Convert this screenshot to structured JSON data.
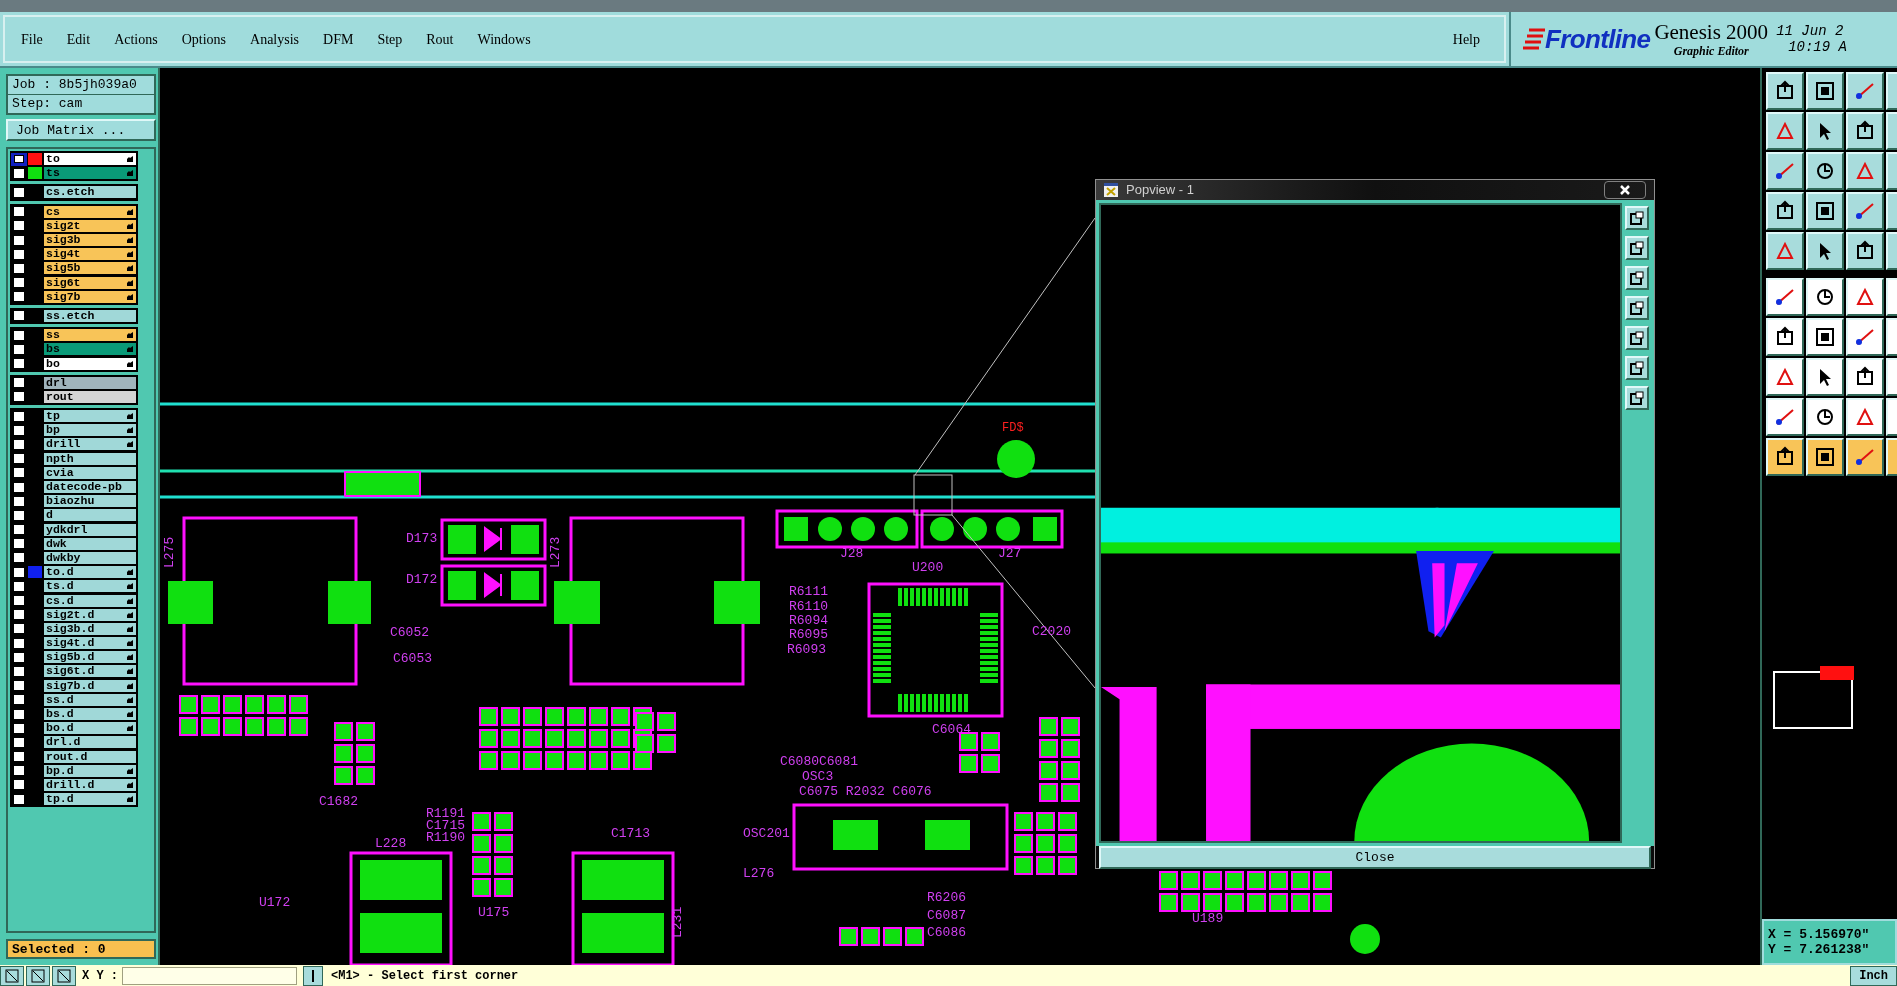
{
  "menu": [
    "File",
    "Edit",
    "Actions",
    "Options",
    "Analysis",
    "DFM",
    "Step",
    "Rout",
    "Windows"
  ],
  "help": "Help",
  "brand": {
    "logo": "Frontline",
    "product": "Genesis 2000",
    "subtitle": "Graphic Editor",
    "date": "11 Jun 2",
    "time": "10:19 A"
  },
  "job": {
    "job": "Job  : 8b5jh039a0",
    "step": "Step: cam",
    "matrix_button": "Job Matrix ..."
  },
  "layer_groups": [
    [
      {
        "name": "to",
        "color": "#ffffff",
        "hand": true,
        "marker": {
          "color": "#ff1010"
        },
        "selected": true,
        "checked": false
      },
      {
        "name": "ts",
        "color": "#0a9a78",
        "hand": true,
        "marker": {
          "color": "#10e010"
        },
        "selected": false,
        "checked": false
      }
    ],
    [
      {
        "name": "cs.etch",
        "color": "#a0d8d8",
        "hand": false,
        "selected": false,
        "checked": false
      }
    ],
    [
      {
        "name": "cs",
        "color": "#f8c458",
        "hand": true,
        "selected": false,
        "checked": false
      },
      {
        "name": "sig2t",
        "color": "#f8c458",
        "hand": true,
        "selected": false,
        "checked": false
      },
      {
        "name": "sig3b",
        "color": "#f8c458",
        "hand": true,
        "selected": false,
        "checked": false
      },
      {
        "name": "sig4t",
        "color": "#f8c458",
        "hand": true,
        "selected": false,
        "checked": false
      },
      {
        "name": "sig5b",
        "color": "#f8c458",
        "hand": true,
        "selected": false,
        "checked": false
      },
      {
        "name": "sig6t",
        "color": "#f8c458",
        "hand": true,
        "selected": false,
        "checked": false
      },
      {
        "name": "sig7b",
        "color": "#f8c458",
        "hand": true,
        "selected": false,
        "checked": false
      }
    ],
    [
      {
        "name": "ss.etch",
        "color": "#a0d8d8",
        "hand": false,
        "selected": false,
        "checked": false
      }
    ],
    [
      {
        "name": "ss",
        "color": "#f8c458",
        "hand": true,
        "selected": false,
        "checked": false
      },
      {
        "name": "bs",
        "color": "#0a9a78",
        "hand": true,
        "selected": false,
        "checked": false
      },
      {
        "name": "bo",
        "color": "#ffffff",
        "hand": true,
        "selected": false,
        "checked": false
      }
    ],
    [
      {
        "name": "drl",
        "color": "#a0b4bc",
        "hand": false,
        "selected": false,
        "checked": false
      },
      {
        "name": "rout",
        "color": "#d4d4d4",
        "hand": false,
        "selected": false,
        "checked": false
      }
    ],
    [
      {
        "name": "tp",
        "color": "#a0d8d8",
        "hand": true,
        "selected": false,
        "checked": false
      },
      {
        "name": "bp",
        "color": "#a0d8d8",
        "hand": true,
        "selected": false,
        "checked": false
      },
      {
        "name": "drill",
        "color": "#a0d8d8",
        "hand": true,
        "selected": false,
        "checked": false
      },
      {
        "name": "npth",
        "color": "#a0d8d8",
        "hand": false,
        "selected": false,
        "checked": false
      },
      {
        "name": "cvia",
        "color": "#a0d8d8",
        "hand": false,
        "selected": false,
        "checked": false
      },
      {
        "name": "datecode-pb",
        "color": "#a0d8d8",
        "hand": false,
        "selected": false,
        "checked": false
      },
      {
        "name": "biaozhu",
        "color": "#a0d8d8",
        "hand": false,
        "selected": false,
        "checked": false
      },
      {
        "name": "d",
        "color": "#a0d8d8",
        "hand": false,
        "selected": false,
        "checked": false
      },
      {
        "name": "ydkdrl",
        "color": "#a0d8d8",
        "hand": false,
        "selected": false,
        "checked": false
      },
      {
        "name": "dwk",
        "color": "#a0d8d8",
        "hand": false,
        "selected": false,
        "checked": false
      },
      {
        "name": "dwkby",
        "color": "#a0d8d8",
        "hand": false,
        "selected": false,
        "checked": false
      },
      {
        "name": "to.d",
        "color": "#a0d8d8",
        "hand": true,
        "marker": {
          "color": "#1020f0"
        },
        "selected": false,
        "checked": false
      },
      {
        "name": "ts.d",
        "color": "#a0d8d8",
        "hand": true,
        "selected": false,
        "checked": false
      },
      {
        "name": "cs.d",
        "color": "#a0d8d8",
        "hand": true,
        "selected": false,
        "checked": false
      },
      {
        "name": "sig2t.d",
        "color": "#a0d8d8",
        "hand": true,
        "selected": false,
        "checked": false
      },
      {
        "name": "sig3b.d",
        "color": "#a0d8d8",
        "hand": true,
        "selected": false,
        "checked": false
      },
      {
        "name": "sig4t.d",
        "color": "#a0d8d8",
        "hand": true,
        "selected": false,
        "checked": false
      },
      {
        "name": "sig5b.d",
        "color": "#a0d8d8",
        "hand": true,
        "selected": false,
        "checked": false
      },
      {
        "name": "sig6t.d",
        "color": "#a0d8d8",
        "hand": true,
        "selected": false,
        "checked": false
      },
      {
        "name": "sig7b.d",
        "color": "#a0d8d8",
        "hand": true,
        "selected": false,
        "checked": false
      },
      {
        "name": "ss.d",
        "color": "#a0d8d8",
        "hand": true,
        "selected": false,
        "checked": false
      },
      {
        "name": "bs.d",
        "color": "#a0d8d8",
        "hand": true,
        "selected": false,
        "checked": false
      },
      {
        "name": "bo.d",
        "color": "#a0d8d8",
        "hand": true,
        "selected": false,
        "checked": false
      },
      {
        "name": "drl.d",
        "color": "#a0d8d8",
        "hand": false,
        "selected": false,
        "checked": false
      },
      {
        "name": "rout.d",
        "color": "#a0d8d8",
        "hand": false,
        "selected": false,
        "checked": false
      },
      {
        "name": "bp.d",
        "color": "#a0d8d8",
        "hand": true,
        "selected": false,
        "checked": false
      },
      {
        "name": "drill.d",
        "color": "#a0d8d8",
        "hand": true,
        "selected": false,
        "checked": false
      },
      {
        "name": "tp.d",
        "color": "#a0d8d8",
        "hand": true,
        "selected": false,
        "checked": false
      }
    ]
  ],
  "selected_count": "Selected : 0",
  "canvas": {
    "drill_label": "FD$",
    "labels": [
      "D173",
      "D172",
      "L275",
      "L273",
      "J28",
      "J27",
      "U200",
      "R6111",
      "R6110",
      "R6094",
      "R6095",
      "R6093",
      "C6052",
      "C6053",
      "C2020",
      "C6064",
      "C6080C6081",
      "OSC3",
      "C6075 R2032 C6076",
      "OSC201",
      "L276",
      "R6206",
      "C6087",
      "C6086",
      "L228",
      "C1682",
      "R1191",
      "C1715",
      "R1190",
      "C1713",
      "U172",
      "U175",
      "L231",
      "U189"
    ]
  },
  "popview": {
    "title": "Popview - 1",
    "close_button": "Close"
  },
  "coordinates": {
    "x": "X = 5.156970\"",
    "y": "Y = 7.261238\""
  },
  "status": {
    "xy_label": "X Y :",
    "prompt": "<M1> - Select first corner",
    "units": "Inch"
  }
}
